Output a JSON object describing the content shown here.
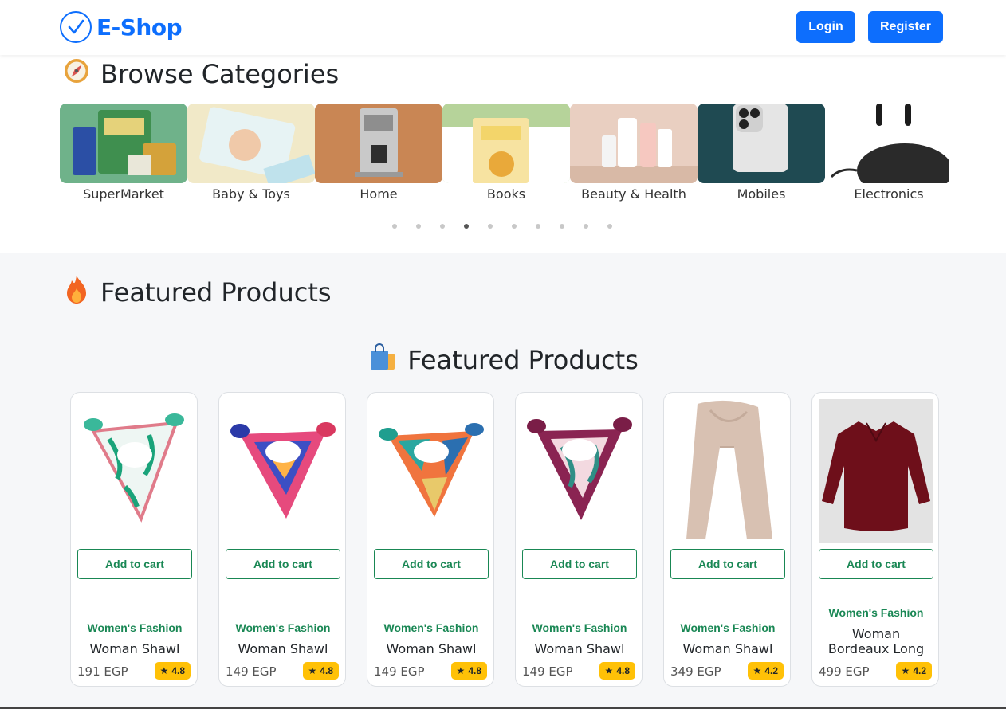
{
  "brand": {
    "name": "E-Shop",
    "icon": "check-circle-icon",
    "color": "#0d6efd"
  },
  "nav": {
    "login": "Login",
    "register": "Register"
  },
  "categories_section": {
    "title": "Browse Categories",
    "icon": "compass-icon",
    "items": [
      {
        "label": "SuperMarket",
        "color": "#6fb28a"
      },
      {
        "label": "Baby & Toys",
        "color": "#f1e9c8"
      },
      {
        "label": "Home",
        "color": "#c98654"
      },
      {
        "label": "Books",
        "color": "#a9c98a"
      },
      {
        "label": "Beauty & Health",
        "color": "#e9cfc1"
      },
      {
        "label": "Mobiles",
        "color": "#1f4a52"
      },
      {
        "label": "Electronics",
        "color": "#ffffff"
      }
    ],
    "dots_count": 10,
    "active_dot": 3
  },
  "featured_section": {
    "title": "Featured Products",
    "icon": "fire-icon",
    "subtitle": "Featured Products",
    "subtitle_icon": "shopping-bag-icon",
    "add_to_cart": "Add to cart",
    "products": [
      {
        "category": "Women's Fashion",
        "title": "Woman Shawl",
        "price": "191 EGP",
        "rating": "4.8",
        "image": "scarf-teal"
      },
      {
        "category": "Women's Fashion",
        "title": "Woman Shawl",
        "price": "149 EGP",
        "rating": "4.8",
        "image": "scarf-multicolor"
      },
      {
        "category": "Women's Fashion",
        "title": "Woman Shawl",
        "price": "149 EGP",
        "rating": "4.8",
        "image": "scarf-orange"
      },
      {
        "category": "Women's Fashion",
        "title": "Woman Shawl",
        "price": "149 EGP",
        "rating": "4.8",
        "image": "scarf-plum"
      },
      {
        "category": "Women's Fashion",
        "title": "Woman Shawl",
        "price": "349 EGP",
        "rating": "4.2",
        "image": "long-shawl-beige"
      },
      {
        "category": "Women's Fashion",
        "title": "Woman Bordeaux Long",
        "price": "499 EGP",
        "rating": "4.2",
        "image": "bordeaux-shirt"
      }
    ]
  },
  "colors": {
    "primary": "#0d6efd",
    "success": "#198754",
    "warning": "#ffc107",
    "section_bg": "#f6f7f9"
  }
}
